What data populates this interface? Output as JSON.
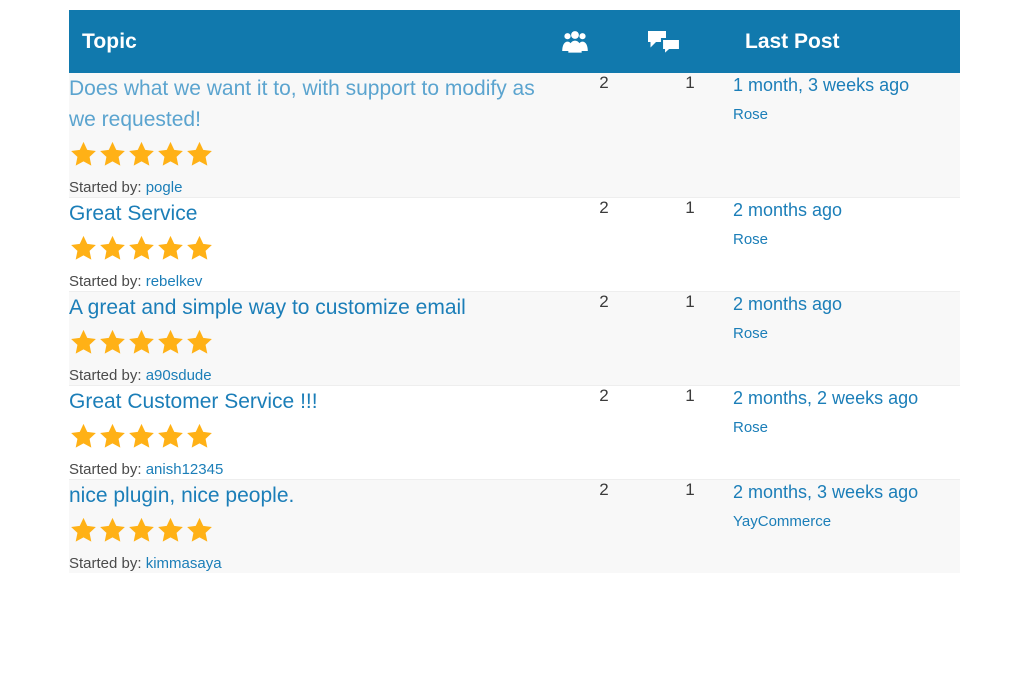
{
  "colors": {
    "header_bg": "#1179ad",
    "link_blue": "#1b7eb8",
    "visited_blue": "#5ba4cf",
    "star_gold": "#ffb116",
    "row_alt_bg": "#f8f8f8",
    "row_bg": "#ffffff",
    "text_dark": "#4a4a4a"
  },
  "header": {
    "topic_label": "Topic",
    "voices_icon": "group-of-people-icon",
    "replies_icon": "speech-bubbles-icon",
    "last_post_label": "Last Post"
  },
  "labels": {
    "started_by": "Started by:"
  },
  "rows": [
    {
      "title": "Does what we want it to, with support to modify as we requested!",
      "visited": true,
      "rating": 5,
      "started_by": "pogle",
      "voices": "2",
      "replies": "1",
      "last_post_time": "1 month, 3 weeks ago",
      "last_post_author": "Rose"
    },
    {
      "title": "Great Service",
      "visited": false,
      "rating": 5,
      "started_by": "rebelkev",
      "voices": "2",
      "replies": "1",
      "last_post_time": "2 months ago",
      "last_post_author": "Rose"
    },
    {
      "title": "A great and simple way to customize email",
      "visited": false,
      "rating": 5,
      "started_by": "a90sdude",
      "voices": "2",
      "replies": "1",
      "last_post_time": "2 months ago",
      "last_post_author": "Rose"
    },
    {
      "title": "Great Customer Service !!!",
      "visited": false,
      "rating": 5,
      "started_by": "anish12345",
      "voices": "2",
      "replies": "1",
      "last_post_time": "2 months, 2 weeks ago",
      "last_post_author": "Rose"
    },
    {
      "title": "nice plugin, nice people.",
      "visited": false,
      "rating": 5,
      "started_by": "kimmasaya",
      "voices": "2",
      "replies": "1",
      "last_post_time": "2 months, 3 weeks ago",
      "last_post_author": "YayCommerce"
    }
  ]
}
